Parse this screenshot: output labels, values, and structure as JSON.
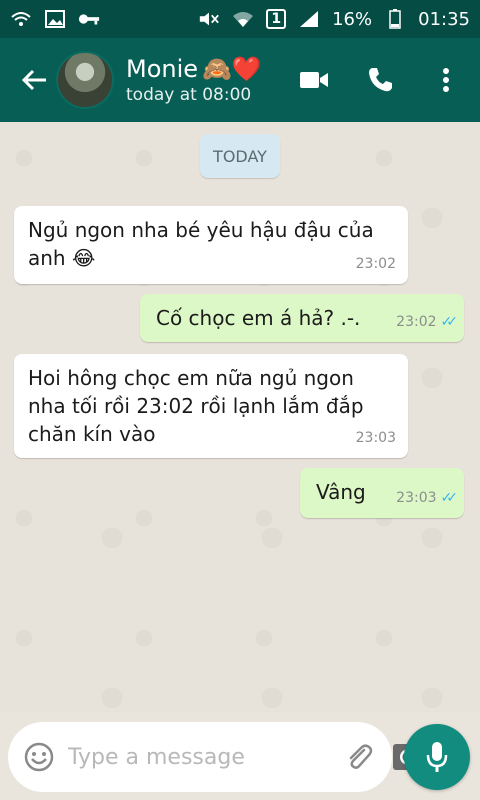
{
  "status_bar": {
    "battery": "16%",
    "time": "01:35",
    "sim": "1"
  },
  "header": {
    "contact_name": "Monie",
    "name_emoji": "🙈❤️",
    "last_seen": "today at 08:00"
  },
  "chat": {
    "date_chip": "TODAY",
    "messages": [
      {
        "direction": "incoming",
        "text": "Ngủ ngon nha bé yêu hậu đậu của anh 😂",
        "time": "23:02"
      },
      {
        "direction": "outgoing",
        "text": "Cố chọc em á hả? .-.",
        "time": "23:02",
        "status": "read"
      },
      {
        "direction": "incoming",
        "text": "Hoi hông chọc em nữa ngủ ngon nha tối rồi 23:02 rồi lạnh lắm đắp chăn kín vào",
        "time": "23:03"
      },
      {
        "direction": "outgoing",
        "text": "Vâng",
        "time": "23:03",
        "status": "read"
      }
    ]
  },
  "composer": {
    "placeholder": "Type a message"
  },
  "colors": {
    "header": "#075e54",
    "status_bar": "#054d44",
    "outgoing_bubble": "#dcf8c6",
    "incoming_bubble": "#ffffff",
    "read_ticks": "#34b7f1",
    "mic_button": "#128c7e"
  },
  "icons": {
    "status_left": [
      "wifi-call-icon",
      "image-icon",
      "key-icon"
    ],
    "status_right": [
      "mute-icon",
      "wifi-icon",
      "sim-icon",
      "signal-icon",
      "battery-icon"
    ],
    "header_actions": [
      "video-call-icon",
      "voice-call-icon",
      "more-options-icon"
    ],
    "composer": [
      "emoji-icon",
      "attach-icon",
      "camera-icon",
      "mic-icon"
    ]
  }
}
